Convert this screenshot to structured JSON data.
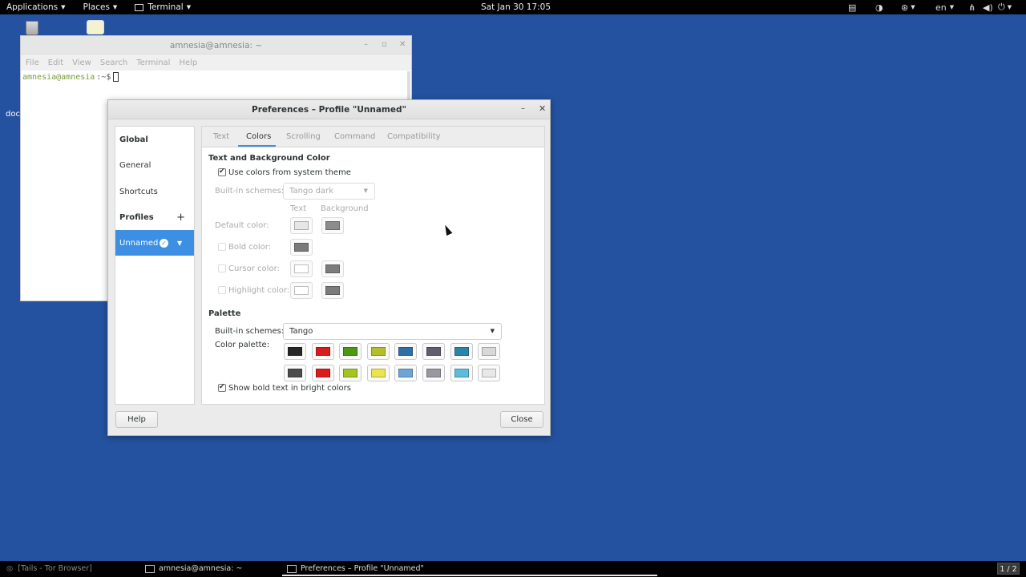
{
  "topbar": {
    "applications": "Applications",
    "places": "Places",
    "terminal": "Terminal",
    "clock": "Sat Jan 30  17:05",
    "language": "en"
  },
  "desktop": {
    "partial_label": "docu"
  },
  "terminal_window": {
    "title": "amnesia@amnesia: ~",
    "menu": [
      "File",
      "Edit",
      "View",
      "Search",
      "Terminal",
      "Help"
    ],
    "prompt_user": "amnesia@amnesia",
    "prompt_suffix": ":~$"
  },
  "prefs": {
    "title": "Preferences – Profile \"Unnamed\"",
    "sidebar": {
      "global": "Global",
      "general": "General",
      "shortcuts": "Shortcuts",
      "profiles": "Profiles",
      "profile_name": "Unnamed"
    },
    "tabs": [
      "Text",
      "Colors",
      "Scrolling",
      "Command",
      "Compatibility"
    ],
    "active_tab": "Colors",
    "text_bg": {
      "heading": "Text and Background Color",
      "use_system": "Use colors from system theme",
      "use_system_checked": true,
      "builtin_label": "Built-in schemes:",
      "builtin_value": "Tango dark",
      "col_text": "Text",
      "col_background": "Background",
      "default_color": "Default color:",
      "bold_color": "Bold color:",
      "cursor_color": "Cursor color:",
      "highlight_color": "Highlight color:",
      "swatches": {
        "default_text": "#e6e6e6",
        "default_bg": "#8c8c8c",
        "bold": "#7a7a7a",
        "cursor_text": "#ffffff",
        "cursor_bg": "#7c7c7c",
        "highlight_text": "#ffffff",
        "highlight_bg": "#7c7c7c"
      }
    },
    "palette": {
      "heading": "Palette",
      "builtin_label": "Built-in schemes:",
      "builtin_value": "Tango",
      "color_palette_label": "Color palette:",
      "row1": [
        "#2e3436",
        "#cc0000",
        "#4e9a06",
        "#c4a000",
        "#3465a4",
        "#75507b",
        "#06989a",
        "#d3d7cf"
      ],
      "row2": [
        "#555753",
        "#ef2929",
        "#8ae234",
        "#fce94f",
        "#729fcf",
        "#ad7fa8",
        "#34e2e2",
        "#eeeeec"
      ],
      "row1_shown": [
        "#262626",
        "#d81c1c",
        "#4a9a10",
        "#b4be2c",
        "#2e6fa4",
        "#5e5e6e",
        "#2a86a8",
        "#d8d8d8"
      ],
      "row2_shown": [
        "#4c4c4c",
        "#dc1c1c",
        "#a4c41e",
        "#ece44c",
        "#6ca4d8",
        "#9898a0",
        "#5cbcdc",
        "#e8e8e8"
      ],
      "bold_bright": "Show bold text in bright colors",
      "bold_bright_checked": true
    },
    "buttons": {
      "help": "Help",
      "close": "Close"
    }
  },
  "taskbar": {
    "items": [
      "[Tails - Tor Browser]",
      "amnesia@amnesia: ~",
      "Preferences – Profile \"Unnamed\""
    ],
    "pager": "1 / 2"
  },
  "colors": {
    "desktop_bg": "#2452a0",
    "accent": "#3d8fe3"
  }
}
